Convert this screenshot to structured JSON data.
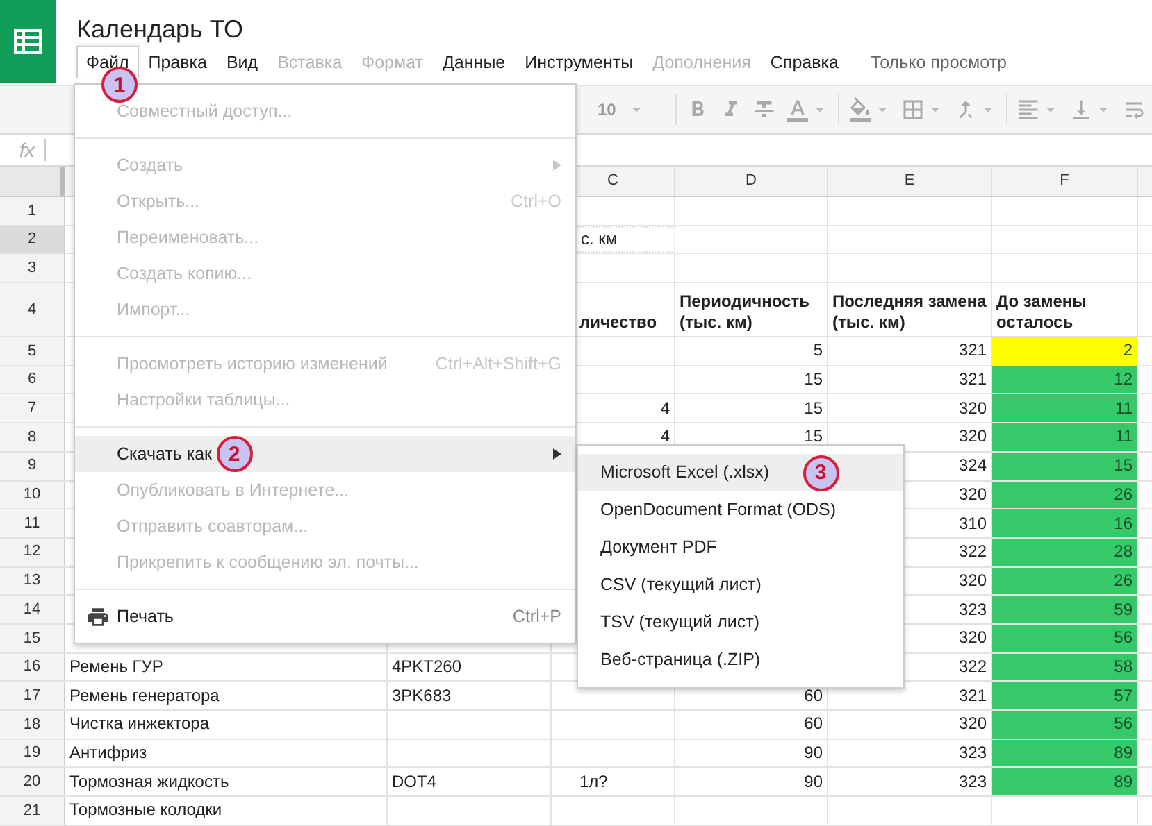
{
  "app": {
    "title": "Календарь ТО",
    "read_only_label": "Только просмотр"
  },
  "menubar": [
    {
      "label": "Файл",
      "disabled": false,
      "open": true,
      "badge": "1"
    },
    {
      "label": "Правка",
      "disabled": false,
      "open": false
    },
    {
      "label": "Вид",
      "disabled": false,
      "open": false
    },
    {
      "label": "Вставка",
      "disabled": true,
      "open": false
    },
    {
      "label": "Формат",
      "disabled": true,
      "open": false
    },
    {
      "label": "Данные",
      "disabled": false,
      "open": false
    },
    {
      "label": "Инструменты",
      "disabled": false,
      "open": false
    },
    {
      "label": "Дополнения",
      "disabled": true,
      "open": false
    },
    {
      "label": "Справка",
      "disabled": false,
      "open": false
    }
  ],
  "toolbar": {
    "font_size": "10"
  },
  "formula_bar": {
    "label": "fx"
  },
  "sheet": {
    "column_headers": [
      "C",
      "D",
      "E",
      "F"
    ],
    "rows": [
      {
        "number": "1",
        "kind": "data",
        "selected": false,
        "cells": [
          null,
          null,
          null,
          null,
          null,
          null
        ]
      },
      {
        "number": "2",
        "kind": "data",
        "selected": true,
        "cells": [
          null,
          null,
          {
            "text": "с. км",
            "marquee": true
          },
          null,
          null,
          null
        ]
      },
      {
        "number": "3",
        "kind": "data",
        "selected": false,
        "cells": [
          null,
          null,
          null,
          null,
          null,
          null
        ]
      },
      {
        "number": "4",
        "kind": "header",
        "selected": false,
        "cells": [
          null,
          null,
          "личество",
          "Периодичность (тыс. км)",
          "Последняя замена (тыс. км)",
          "До замены осталось"
        ]
      },
      {
        "number": "5",
        "kind": "data",
        "selected": false,
        "color": "#ffff00",
        "cells": [
          null,
          null,
          null,
          "5",
          "321",
          "2"
        ]
      },
      {
        "number": "6",
        "kind": "data",
        "selected": false,
        "color": "#35c96a",
        "cells": [
          null,
          null,
          null,
          "15",
          "321",
          "12"
        ]
      },
      {
        "number": "7",
        "kind": "data",
        "selected": false,
        "color": "#35c96a",
        "cells": [
          null,
          null,
          "4",
          "15",
          "320",
          "11"
        ]
      },
      {
        "number": "8",
        "kind": "data",
        "selected": false,
        "color": "#35c96a",
        "cells": [
          null,
          null,
          "4",
          "15",
          "320",
          "11"
        ]
      },
      {
        "number": "9",
        "kind": "data",
        "selected": false,
        "color": "#35c96a",
        "cells": [
          null,
          null,
          null,
          null,
          "324",
          "15"
        ]
      },
      {
        "number": "10",
        "kind": "data",
        "selected": false,
        "color": "#35c96a",
        "cells": [
          null,
          null,
          null,
          null,
          "320",
          "26"
        ]
      },
      {
        "number": "11",
        "kind": "data",
        "selected": false,
        "color": "#35c96a",
        "cells": [
          null,
          null,
          null,
          null,
          "310",
          "16"
        ]
      },
      {
        "number": "12",
        "kind": "data",
        "selected": false,
        "color": "#35c96a",
        "cells": [
          null,
          null,
          null,
          null,
          "322",
          "28"
        ]
      },
      {
        "number": "13",
        "kind": "data",
        "selected": false,
        "color": "#35c96a",
        "cells": [
          null,
          null,
          null,
          null,
          "320",
          "26"
        ]
      },
      {
        "number": "14",
        "kind": "data",
        "selected": false,
        "color": "#35c96a",
        "cells": [
          null,
          null,
          null,
          null,
          "323",
          "59"
        ]
      },
      {
        "number": "15",
        "kind": "data",
        "selected": false,
        "color": "#35c96a",
        "cells": [
          null,
          null,
          null,
          null,
          "320",
          "56"
        ]
      },
      {
        "number": "16",
        "kind": "data",
        "selected": false,
        "color": "#35c96a",
        "cells": [
          "Ремень ГУР",
          "4PKT260",
          null,
          null,
          "322",
          "58"
        ]
      },
      {
        "number": "17",
        "kind": "data",
        "selected": false,
        "color": "#35c96a",
        "cells": [
          "Ремень генератора",
          "3PK683",
          null,
          "60",
          "321",
          "57"
        ]
      },
      {
        "number": "18",
        "kind": "data",
        "selected": false,
        "color": "#35c96a",
        "cells": [
          "Чистка инжектора",
          null,
          null,
          "60",
          "320",
          "56"
        ]
      },
      {
        "number": "19",
        "kind": "data",
        "selected": false,
        "color": "#35c96a",
        "cells": [
          "Антифриз",
          null,
          null,
          "90",
          "323",
          "89"
        ]
      },
      {
        "number": "20",
        "kind": "data",
        "selected": false,
        "color": "#35c96a",
        "cells": [
          "Тормозная жидкость",
          "DOT4",
          "1л?",
          "90",
          "323",
          "89"
        ]
      },
      {
        "number": "21",
        "kind": "data",
        "selected": false,
        "cells": [
          "Тормозные колодки",
          null,
          null,
          null,
          null,
          null
        ]
      }
    ]
  },
  "file_menu": {
    "groups": [
      [
        {
          "label": "Совместный доступ...",
          "kind": "command",
          "disabled": true,
          "selected": false,
          "submenu": false
        }
      ],
      [
        {
          "label": "Создать",
          "kind": "command",
          "disabled": true,
          "selected": false,
          "submenu": true
        },
        {
          "label": "Открыть...",
          "kind": "command",
          "disabled": true,
          "selected": false,
          "submenu": false,
          "shortcut": "Ctrl+O"
        },
        {
          "label": "Переименовать...",
          "kind": "command",
          "disabled": true,
          "selected": false,
          "submenu": false
        },
        {
          "label": "Создать копию...",
          "kind": "command",
          "disabled": true,
          "selected": false,
          "submenu": false
        },
        {
          "label": "Импорт...",
          "kind": "command",
          "disabled": true,
          "selected": false,
          "submenu": false
        }
      ],
      [
        {
          "label": "Просмотреть историю изменений",
          "kind": "command",
          "disabled": true,
          "selected": false,
          "submenu": false,
          "shortcut": "Ctrl+Alt+Shift+G"
        },
        {
          "label": "Настройки таблицы...",
          "kind": "command",
          "disabled": true,
          "selected": false,
          "submenu": false
        }
      ],
      [
        {
          "label": "Скачать как",
          "kind": "command",
          "disabled": false,
          "selected": true,
          "submenu": true,
          "badge": "2"
        },
        {
          "label": "Опубликовать в Интернете...",
          "kind": "command",
          "disabled": true,
          "selected": false,
          "submenu": false
        },
        {
          "label": "Отправить соавторам...",
          "kind": "command",
          "disabled": true,
          "selected": false,
          "submenu": false
        },
        {
          "label": "Прикрепить к сообщению эл. почты...",
          "kind": "command",
          "disabled": true,
          "selected": false,
          "submenu": false
        }
      ],
      [
        {
          "label": "Печать",
          "kind": "print",
          "disabled": false,
          "selected": false,
          "submenu": false,
          "shortcut": "Ctrl+P"
        }
      ]
    ]
  },
  "download_submenu": {
    "items": [
      {
        "label": "Microsoft Excel (.xlsx)",
        "selected": true,
        "badge": "3"
      },
      {
        "label": "OpenDocument Format (ODS)",
        "selected": false
      },
      {
        "label": "Документ PDF",
        "selected": false
      },
      {
        "label": "CSV (текущий лист)",
        "selected": false
      },
      {
        "label": "TSV (текущий лист)",
        "selected": false
      },
      {
        "label": "Веб-страница (.ZIP)",
        "selected": false
      }
    ]
  }
}
